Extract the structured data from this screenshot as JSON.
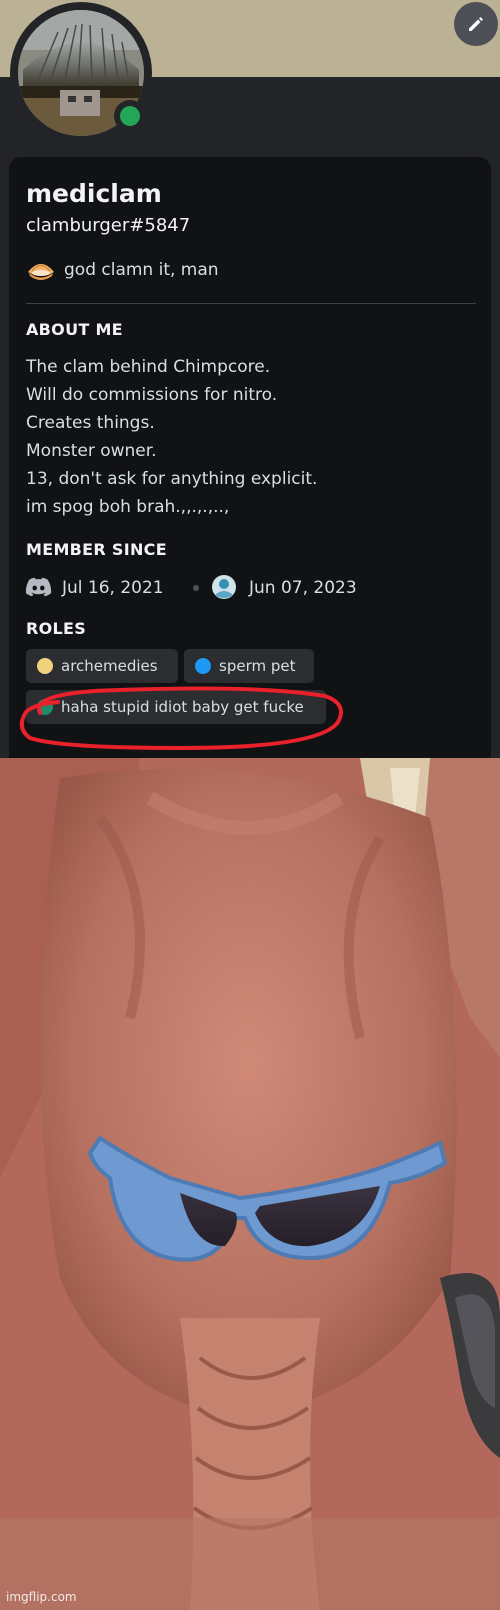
{
  "profile": {
    "display_name": "mediclam",
    "username": "clamburger#5847",
    "status_text": "god clamn it, man",
    "status_emoji": "clam-emoji",
    "online_color": "#23a55a",
    "banner_color": "#bbb295"
  },
  "about": {
    "title": "ABOUT ME",
    "lines": [
      "The clam behind Chimpcore.",
      "Will do commissions for nitro.",
      "Creates things.",
      "Monster owner.",
      "13, don't ask for anything explicit.",
      "im spog boh brah.,,.,.,..,"
    ]
  },
  "member_since": {
    "title": "MEMBER SINCE",
    "discord_date": "Jul 16, 2021",
    "server_date": "Jun 07, 2023"
  },
  "roles": {
    "title": "ROLES",
    "items": [
      {
        "name": "archemedies",
        "color": "#f0d27e"
      },
      {
        "name": "sperm pet",
        "color": "#1e9af5"
      },
      {
        "name": "haha stupid idiot baby get fucke",
        "color": "#1f8b6b"
      }
    ],
    "highlight_color": "#e8212b"
  },
  "meme_image": {
    "description_icon": "monkey-with-sunglasses"
  },
  "watermark": "imgflip.com"
}
